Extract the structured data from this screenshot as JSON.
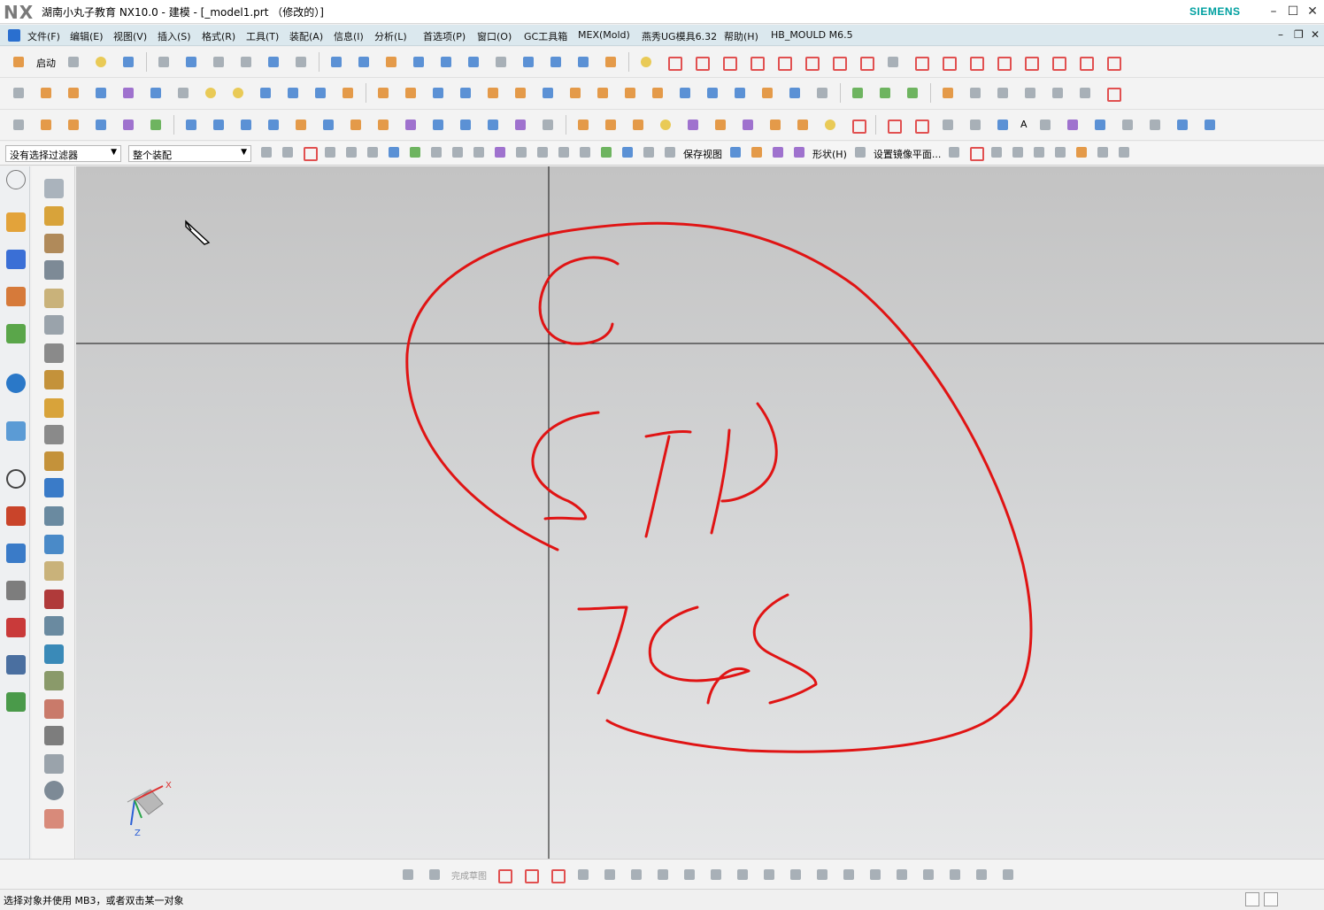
{
  "window": {
    "logo": "NX",
    "title": "湖南小丸子教育 NX10.0 - 建模 - [_model1.prt （修改的）]",
    "brand": "SIEMENS",
    "minimize": "–",
    "maximize": "☐",
    "close": "✕"
  },
  "menubar": {
    "items": [
      "文件(F)",
      "编辑(E)",
      "视图(V)",
      "插入(S)",
      "格式(R)",
      "工具(T)",
      "装配(A)",
      "信息(I)",
      "分析(L)",
      "首选项(P)",
      "窗口(O)",
      "GC工具箱",
      "MEX(Mold)",
      "燕秀UG模具6.32",
      "帮助(H)",
      "HB_MOULD M6.5"
    ],
    "mdi_minimize": "–",
    "mdi_restore": "❐",
    "mdi_close": "✕"
  },
  "toolbar": {
    "start_label": "启动",
    "selection_filter": "没有选择过滤器",
    "assembly_scope": "整个装配",
    "save_view_label": "保存视图",
    "shape_label": "形状(H)",
    "mirror_plane_label": "设置镜像平面..."
  },
  "sketch_toolbar": {
    "finish_sketch_label": "完成草图"
  },
  "viewport": {
    "triad_x": "X",
    "triad_z": "Z",
    "annotation_words": [
      "C",
      "STP",
      "IGS"
    ],
    "annotation_color": "#e01414"
  },
  "statusbar": {
    "message": "选择对象并使用 MB3，或者双击某一对象"
  },
  "colors": {
    "menubar_bg": "#dbe8ee",
    "brand": "#00a0a0",
    "viewport_top": "#c3c3c3",
    "viewport_bottom": "#e6e7e8"
  }
}
